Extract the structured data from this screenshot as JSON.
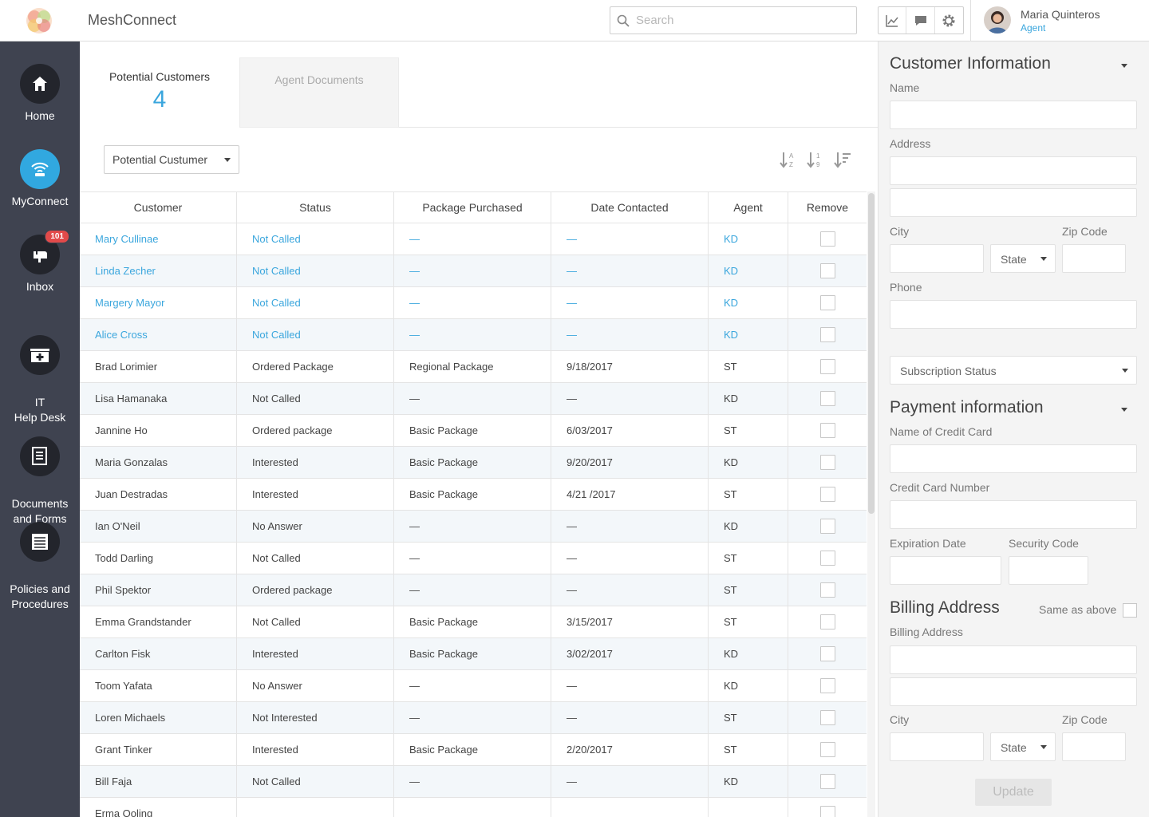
{
  "header": {
    "app_title": "MeshConnect",
    "search_placeholder": "Search",
    "user_name": "Maria Quinteros",
    "user_role": "Agent"
  },
  "sidebar": {
    "items": [
      {
        "label": "Home",
        "icon": "home-icon"
      },
      {
        "label": "MyConnect",
        "icon": "wifi-icon",
        "active": true
      },
      {
        "label": "Inbox",
        "icon": "mailbox-icon",
        "badge": "101"
      },
      {
        "label": "IT\nHelp Desk",
        "icon": "first-aid-icon"
      },
      {
        "label": "Documents\nand Forms",
        "icon": "document-icon"
      },
      {
        "label": "Policies and\nProcedures",
        "icon": "book-icon"
      }
    ]
  },
  "tabs": {
    "potential_label": "Potential Customers",
    "potential_count": "4",
    "agent_docs_label": "Agent Documents"
  },
  "filter": {
    "selected": "Potential Custumer"
  },
  "table": {
    "headers": [
      "Customer",
      "Status",
      "Package Purchased",
      "Date Contacted",
      "Agent",
      "Remove"
    ],
    "rows": [
      {
        "customer": "Mary Cullinae",
        "status": "Not Called",
        "package": "—",
        "date": "—",
        "agent": "KD",
        "highlight": true
      },
      {
        "customer": "Linda Zecher",
        "status": "Not Called",
        "package": "—",
        "date": "—",
        "agent": "KD",
        "highlight": true
      },
      {
        "customer": "Margery Mayor",
        "status": "Not Called",
        "package": "—",
        "date": "—",
        "agent": "KD",
        "highlight": true
      },
      {
        "customer": "Alice Cross",
        "status": "Not Called",
        "package": "—",
        "date": "—",
        "agent": "KD",
        "highlight": true
      },
      {
        "customer": "Brad Lorimier",
        "status": "Ordered Package",
        "package": "Regional Package",
        "date": "9/18/2017",
        "agent": "ST"
      },
      {
        "customer": "Lisa Hamanaka",
        "status": "Not Called",
        "package": "—",
        "date": "—",
        "agent": "KD"
      },
      {
        "customer": "Jannine Ho",
        "status": "Ordered package",
        "package": "Basic Package",
        "date": "6/03/2017",
        "agent": "ST"
      },
      {
        "customer": "Maria Gonzalas",
        "status": "Interested",
        "package": "Basic Package",
        "date": "9/20/2017",
        "agent": "KD"
      },
      {
        "customer": "Juan Destradas",
        "status": "Interested",
        "package": "Basic Package",
        "date": "4/21 /2017",
        "agent": "ST"
      },
      {
        "customer": "Ian O'Neil",
        "status": "No Answer",
        "package": "—",
        "date": "—",
        "agent": "KD"
      },
      {
        "customer": "Todd Darling",
        "status": "Not Called",
        "package": "—",
        "date": "—",
        "agent": "ST"
      },
      {
        "customer": "Phil Spektor",
        "status": "Ordered package",
        "package": "—",
        "date": "—",
        "agent": "ST"
      },
      {
        "customer": "Emma Grandstander",
        "status": "Not Called",
        "package": "Basic Package",
        "date": "3/15/2017",
        "agent": "ST"
      },
      {
        "customer": "Carlton Fisk",
        "status": "Interested",
        "package": "Basic Package",
        "date": "3/02/2017",
        "agent": "KD"
      },
      {
        "customer": "Toom Yafata",
        "status": "No Answer",
        "package": "—",
        "date": "—",
        "agent": "KD"
      },
      {
        "customer": "Loren Michaels",
        "status": "Not Interested",
        "package": "—",
        "date": "—",
        "agent": "ST"
      },
      {
        "customer": "Grant Tinker",
        "status": "Interested",
        "package": "Basic Package",
        "date": "2/20/2017",
        "agent": "ST"
      },
      {
        "customer": "Bill Faja",
        "status": "Not Called",
        "package": "—",
        "date": "—",
        "agent": "KD"
      },
      {
        "customer": "Erma Ooling",
        "status": "",
        "package": "",
        "date": "",
        "agent": ""
      }
    ]
  },
  "panel": {
    "customer_info_title": "Customer Information",
    "name_label": "Name",
    "address_label": "Address",
    "city_label": "City",
    "state_label": "State",
    "zip_label": "Zip Code",
    "phone_label": "Phone",
    "subscription_status": "Subscription Status",
    "payment_title": "Payment information",
    "cc_name_label": "Name of Credit Card",
    "cc_number_label": "Credit Card Number",
    "exp_label": "Expiration Date",
    "security_label": "Security Code",
    "billing_title": "Billing Address",
    "same_as_above": "Same as above",
    "billing_label": "Billing Address",
    "billing_city_label": "City",
    "billing_state_label": "State",
    "billing_zip_label": "Zip Code",
    "update_label": "Update"
  },
  "colors": {
    "accent": "#3aa6dd",
    "sidebar_bg": "#3f4350",
    "badge": "#e24a4a"
  }
}
